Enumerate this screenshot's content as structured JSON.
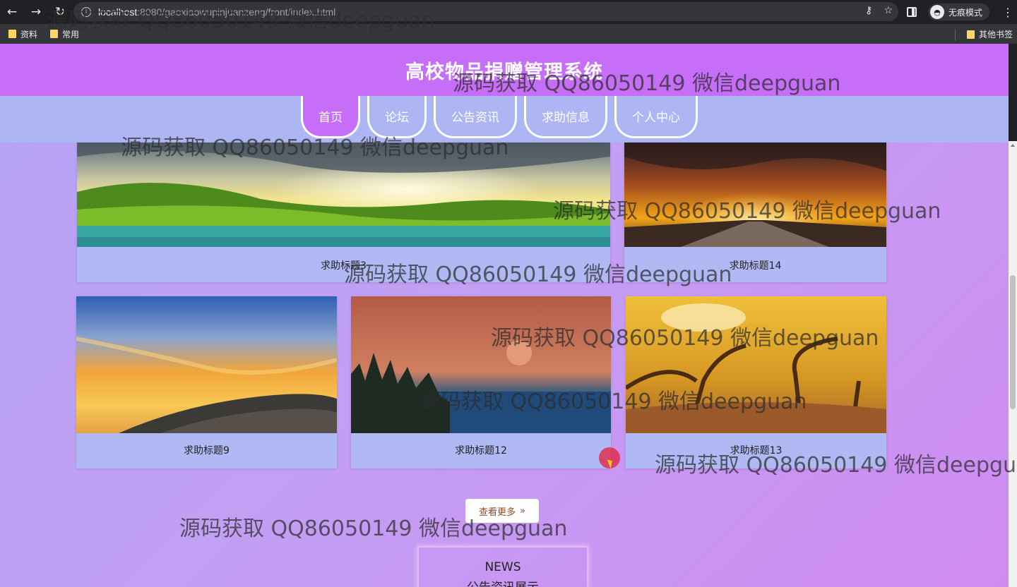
{
  "browser": {
    "url_host": "localhost",
    "url_rest": ":8080/gaoxiaowupinjuanzeng/front/index.html",
    "incognito_label": "无痕模式",
    "bookmarks": [
      "资料",
      "常用"
    ],
    "other_bookmarks": "其他书签"
  },
  "site": {
    "title": "高校物品捐赠管理系统",
    "nav": [
      "首页",
      "论坛",
      "公告资讯",
      "求助信息",
      "个人中心"
    ]
  },
  "cards": [
    {
      "title": "求助标题3",
      "scene": "green-hills-sunset"
    },
    {
      "title": "求助标题14",
      "scene": "road-sunset"
    },
    {
      "title": "求助标题9",
      "scene": "sea-sunset"
    },
    {
      "title": "求助标题12",
      "scene": "lake-forest-moon"
    },
    {
      "title": "求助标题13",
      "scene": "autumn-trees"
    }
  ],
  "more_button": {
    "label": "查看更多",
    "icon": "double-chevron-right-icon"
  },
  "news": {
    "en": "NEWS",
    "cn": "公告资讯展示"
  },
  "watermark_text": "源码获取 QQ86050149 微信deepguan"
}
